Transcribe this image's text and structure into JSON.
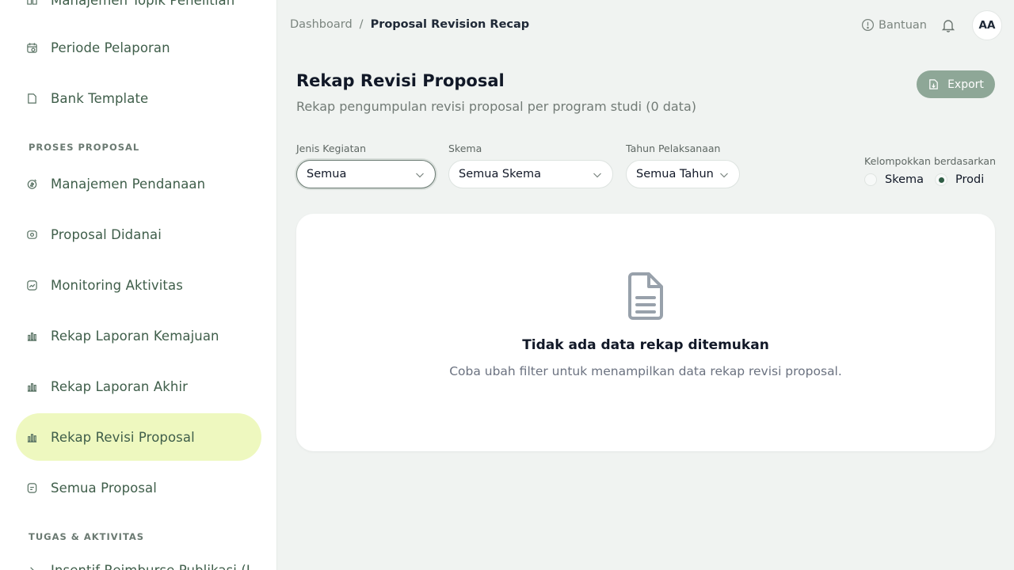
{
  "sidebar": {
    "items": [
      {
        "label": "Manajemen Topik Penelitian",
        "icon": "book-icon"
      },
      {
        "label": "Periode Pelaporan",
        "icon": "calendar-icon"
      },
      {
        "label": "Bank Template",
        "icon": "file-icon"
      },
      {
        "label": "Manajemen Pendanaan",
        "icon": "funding-icon"
      },
      {
        "label": "Proposal Didanai",
        "icon": "money-icon"
      },
      {
        "label": "Monitoring Aktivitas",
        "icon": "activity-chart-icon"
      },
      {
        "label": "Rekap Laporan Kemajuan",
        "icon": "bar-chart-icon"
      },
      {
        "label": "Rekap Laporan Akhir",
        "icon": "bar-chart-icon"
      },
      {
        "label": "Rekap Revisi Proposal",
        "icon": "bar-chart-icon",
        "active": true
      },
      {
        "label": "Semua Proposal",
        "icon": "document-icon"
      },
      {
        "label": "Insentif Reimburse Publikasi (I",
        "icon": "publication-icon"
      }
    ],
    "sections": {
      "proses": "PROSES PROPOSAL",
      "tugas": "TUGAS & AKTIVITAS"
    }
  },
  "topbar": {
    "breadcrumb": {
      "home": "Dashboard",
      "separator": "/",
      "current": "Proposal Revision Recap"
    },
    "help_label": "Bantuan",
    "avatar_initials": "AA"
  },
  "header": {
    "title": "Rekap Revisi Proposal",
    "subtitle": "Rekap pengumpulan revisi proposal per program studi (0 data)",
    "export_label": "Export"
  },
  "filters": {
    "jenis": {
      "label": "Jenis Kegiatan",
      "value": "Semua"
    },
    "skema": {
      "label": "Skema",
      "value": "Semua Skema"
    },
    "tahun": {
      "label": "Tahun Pelaksanaan",
      "value": "Semua Tahun"
    },
    "group": {
      "label": "Kelompokkan berdasarkan",
      "options": [
        "Skema",
        "Prodi"
      ],
      "selected": "Prodi"
    }
  },
  "empty": {
    "title": "Tidak ada data rekap ditemukan",
    "subtitle": "Coba ubah filter untuk menampilkan data rekap revisi proposal."
  },
  "colors": {
    "accent": "#2f5d45",
    "active_nav_bg": "#eef8bf",
    "export_bg": "#8ea797",
    "background": "#f0f3f1"
  }
}
